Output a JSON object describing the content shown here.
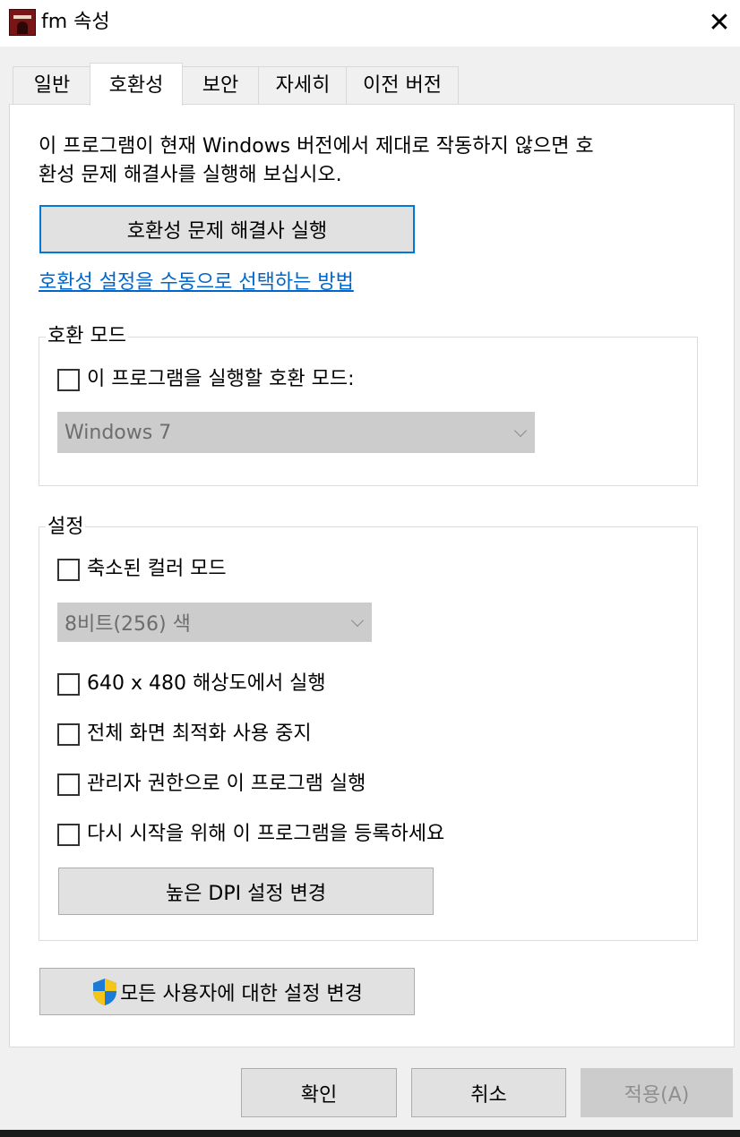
{
  "window": {
    "title": "fm 속성",
    "close_glyph": "✕",
    "app_icon": "app-icon"
  },
  "tabs": [
    {
      "label": "일반"
    },
    {
      "label": "호환성",
      "active": true
    },
    {
      "label": "보안"
    },
    {
      "label": "자세히"
    },
    {
      "label": "이전 버전"
    }
  ],
  "compat": {
    "intro_line1": "이 프로그램이 현재 Windows 버전에서 제대로 작동하지 않으면 호",
    "intro_line2": "환성 문제 해결사를 실행해 보십시오.",
    "troubleshooter_button": "호환성 문제 해결사 실행",
    "manual_link": "호환성 설정을 수동으로 선택하는 방법"
  },
  "compat_mode": {
    "group_label": "호환 모드",
    "checkbox_label": "이 프로그램을 실행할 호환 모드:",
    "checked": false,
    "selected_os": "Windows 7"
  },
  "settings": {
    "group_label": "설정",
    "reduced_color_label": "축소된 컬러 모드",
    "reduced_color_checked": false,
    "color_select_value": "8비트(256) 색",
    "res_640_label": "640 x 480 해상도에서 실행",
    "fullscreen_opt_label": "전체 화면 최적화 사용 중지",
    "run_as_admin_label": "관리자 권한으로 이 프로그램 실행",
    "register_restart_label": "다시 시작을 위해 이 프로그램을 등록하세요",
    "high_dpi_button": "높은 DPI 설정 변경"
  },
  "all_users_button": "모든 사용자에 대한 설정 변경",
  "footer": {
    "ok": "확인",
    "cancel": "취소",
    "apply": "적용(A)"
  },
  "colors": {
    "link": "#0066cc",
    "focus_border": "#0078d7",
    "shield_blue": "#1c7bd6",
    "shield_yellow": "#f5c518"
  }
}
